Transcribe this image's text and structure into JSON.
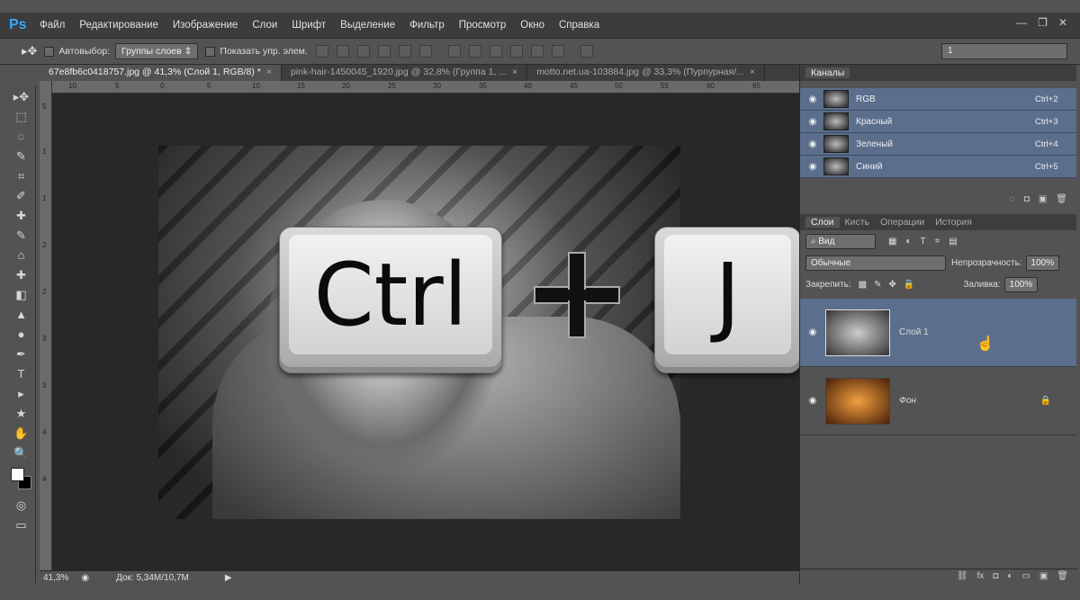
{
  "app": {
    "logo": "Ps"
  },
  "menu": [
    "Файл",
    "Редактирование",
    "Изображение",
    "Слои",
    "Шрифт",
    "Выделение",
    "Фильтр",
    "Просмотр",
    "Окно",
    "Справка"
  ],
  "window_controls": [
    "—",
    "❐",
    "✕"
  ],
  "options": {
    "autoselect_label": "Автовыбор:",
    "autoselect_value": "Группы слоев",
    "show_controls_label": "Показать упр. элем.",
    "right_field": "1"
  },
  "tabs": [
    {
      "label": "67e8fb6c0418757.jpg @ 41,3% (Слой 1, RGB/8) *",
      "close": "×"
    },
    {
      "label": "pink-hair-1450045_1920.jpg @ 32,8% (Группа 1, ...",
      "close": "×"
    },
    {
      "label": "motto.net.ua-103884.jpg @ 33,3% (Пурпурная/...",
      "close": "×"
    }
  ],
  "ruler_h": [
    "10",
    "5",
    "0",
    "5",
    "10",
    "15",
    "20",
    "25",
    "30",
    "35",
    "40",
    "45",
    "50",
    "55",
    "60",
    "65"
  ],
  "ruler_v": [
    "5",
    "1",
    "1",
    "2",
    "2",
    "3",
    "3",
    "4",
    "4"
  ],
  "overlay": {
    "ctrl": "Ctrl",
    "j": "J"
  },
  "tools": [
    "▸✥",
    "⬚",
    "◌",
    "✎",
    "⌗",
    "✐",
    "✚",
    "✎",
    "⌂",
    "✚",
    "◧",
    "▲",
    "●",
    "✒",
    "T",
    "▸",
    "★",
    "✋",
    "🔍"
  ],
  "status": {
    "zoom": "41,3%",
    "doc": "Док: 5,34M/10,7M"
  },
  "channels": {
    "title": "Каналы",
    "items": [
      {
        "name": "RGB",
        "shortcut": "Ctrl+2"
      },
      {
        "name": "Красный",
        "shortcut": "Ctrl+3"
      },
      {
        "name": "Зеленый",
        "shortcut": "Ctrl+4"
      },
      {
        "name": "Синий",
        "shortcut": "Ctrl+5"
      }
    ]
  },
  "layers_panel": {
    "tabs": [
      "Слои",
      "Кисть",
      "Операции",
      "История"
    ],
    "filter": "Вид",
    "blend": "Обычные",
    "opacity_label": "Непрозрачность:",
    "opacity": "100%",
    "lock_label": "Закрепить:",
    "fill_label": "Заливка:",
    "fill": "100%",
    "layers": [
      {
        "name": "Слой 1"
      },
      {
        "name": "Фон"
      }
    ]
  }
}
